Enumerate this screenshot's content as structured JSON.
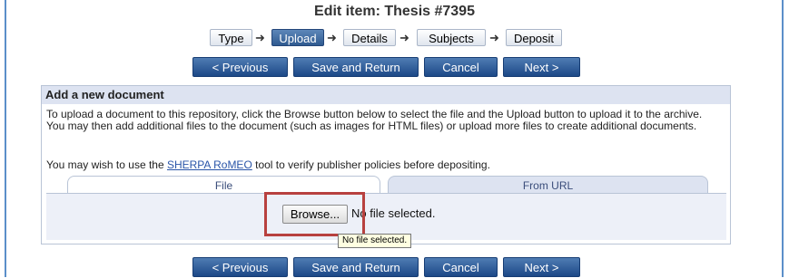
{
  "page": {
    "title": "Edit item: Thesis #7395"
  },
  "workflow": {
    "steps": [
      {
        "label": "Type",
        "active": false
      },
      {
        "label": "Upload",
        "active": true
      },
      {
        "label": "Details",
        "active": false
      },
      {
        "label": "Subjects",
        "active": false
      },
      {
        "label": "Deposit",
        "active": false
      }
    ],
    "arrow": "➜"
  },
  "buttons": {
    "previous": "< Previous",
    "save_return": "Save and Return",
    "cancel": "Cancel",
    "next": "Next >"
  },
  "panel": {
    "heading": "Add a new document",
    "description": "To upload a document to this repository, click the Browse button below to select the file and the Upload button to upload it to the archive. You may then add additional files to the document (such as images for HTML files) or upload more files to create additional documents.",
    "sherpa_prefix": "You may wish to use the ",
    "sherpa_link": "SHERPA RoMEO",
    "sherpa_suffix": " tool to verify publisher policies before depositing."
  },
  "tabs": {
    "file": "File",
    "url": "From URL"
  },
  "file_input": {
    "browse_label": "Browse...",
    "status": "No file selected.",
    "tooltip": "No file selected."
  },
  "colors": {
    "highlight": "#b8413f",
    "button": "#2a5590",
    "accent": "#5b8fc9"
  }
}
